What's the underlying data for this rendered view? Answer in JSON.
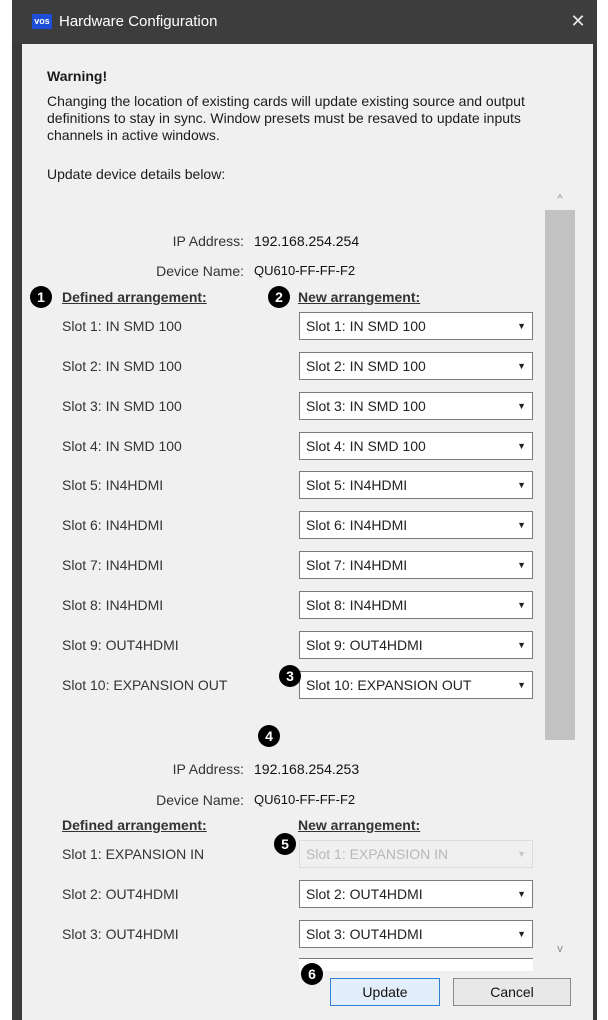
{
  "window": {
    "logo_text": "vos",
    "title": "Hardware Configuration",
    "close_glyph": "✕"
  },
  "warning": {
    "heading": "Warning!",
    "body": "Changing the location of existing cards will update existing source and output definitions to stay in sync. Window presets must be resaved to update inputs channels in active windows.",
    "prompt": "Update device details below:"
  },
  "labels": {
    "ip_address": "IP Address:",
    "device_name": "Device Name:",
    "defined_arrangement": "Defined arrangement:",
    "new_arrangement": "New arrangement:"
  },
  "devices": [
    {
      "ip": "192.168.254.254",
      "name": "QU610-FF-FF-F2",
      "slots": [
        {
          "defined": "Slot 1: IN SMD 100",
          "selected": "Slot 1: IN SMD 100",
          "enabled": true
        },
        {
          "defined": "Slot 2: IN SMD 100",
          "selected": "Slot 2: IN SMD 100",
          "enabled": true
        },
        {
          "defined": "Slot 3: IN SMD 100",
          "selected": "Slot 3: IN SMD 100",
          "enabled": true
        },
        {
          "defined": "Slot 4: IN SMD 100",
          "selected": "Slot 4: IN SMD 100",
          "enabled": true
        },
        {
          "defined": "Slot 5: IN4HDMI",
          "selected": "Slot 5: IN4HDMI",
          "enabled": true
        },
        {
          "defined": "Slot 6: IN4HDMI",
          "selected": "Slot 6: IN4HDMI",
          "enabled": true
        },
        {
          "defined": "Slot 7: IN4HDMI",
          "selected": "Slot 7: IN4HDMI",
          "enabled": true
        },
        {
          "defined": "Slot 8: IN4HDMI",
          "selected": "Slot 8: IN4HDMI",
          "enabled": true
        },
        {
          "defined": "Slot 9: OUT4HDMI",
          "selected": "Slot 9: OUT4HDMI",
          "enabled": true
        },
        {
          "defined": "Slot 10: EXPANSION OUT",
          "selected": "Slot 10: EXPANSION OUT",
          "enabled": true
        }
      ]
    },
    {
      "ip": "192.168.254.253",
      "name": "QU610-FF-FF-F2",
      "slots": [
        {
          "defined": "Slot 1: EXPANSION IN",
          "selected": "Slot 1: EXPANSION IN",
          "enabled": false
        },
        {
          "defined": "Slot 2: OUT4HDMI",
          "selected": "Slot 2: OUT4HDMI",
          "enabled": true
        },
        {
          "defined": "Slot 3: OUT4HDMI",
          "selected": "Slot 3: OUT4HDMI",
          "enabled": true
        }
      ]
    }
  ],
  "callouts": [
    "1",
    "2",
    "3",
    "4",
    "5",
    "6"
  ],
  "buttons": {
    "update": "Update",
    "cancel": "Cancel"
  },
  "scrollbar": {
    "up_glyph": "^",
    "down_glyph": "v"
  },
  "colors": {
    "titlebar": "#3d3d3d",
    "dialog_bg": "#f0f0f0",
    "logo_bg": "#1d4ed8",
    "update_border": "#2f7fd6"
  }
}
